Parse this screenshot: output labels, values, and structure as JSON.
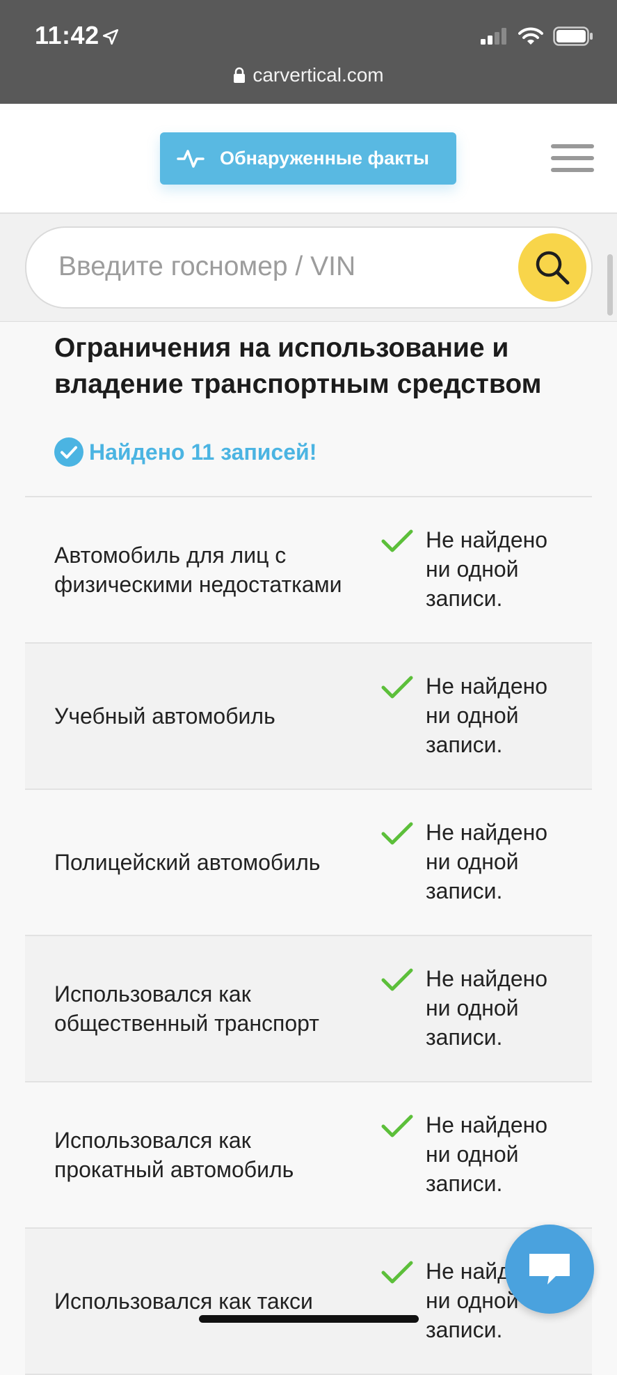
{
  "status_bar": {
    "time": "11:42",
    "url": "carvertical.com"
  },
  "header": {
    "facts_button": "Обнаруженные факты"
  },
  "search": {
    "placeholder": "Введите госномер / VIN"
  },
  "section": {
    "title": "Ограничения на использование и владение транспортным средством",
    "found_label": "Найдено 11 записей!"
  },
  "rows": [
    {
      "name": "Автомобиль для лиц с физическими недостатками",
      "status": "Не найдено ни одной записи."
    },
    {
      "name": "Учебный автомобиль",
      "status": "Не найдено ни одной записи."
    },
    {
      "name": "Полицейский автомобиль",
      "status": "Не найдено ни одной записи."
    },
    {
      "name": "Использовался как общественный транспорт",
      "status": "Не найдено ни одной записи."
    },
    {
      "name": "Использовался как прокатный автомобиль",
      "status": "Не найдено ни одной записи."
    },
    {
      "name": "Использовался как такси",
      "status": "Не найдено ни одной записи."
    }
  ],
  "colors": {
    "accent": "#59b9e2",
    "search_button": "#f8d54a",
    "check": "#5cbf3a",
    "chat": "#4aa2de"
  },
  "icons": [
    "location-arrow-icon",
    "signal-icon",
    "wifi-icon",
    "battery-icon",
    "lock-icon",
    "pulse-icon",
    "hamburger-menu-icon",
    "search-icon",
    "check-circle-icon",
    "check-icon",
    "chat-icon"
  ]
}
